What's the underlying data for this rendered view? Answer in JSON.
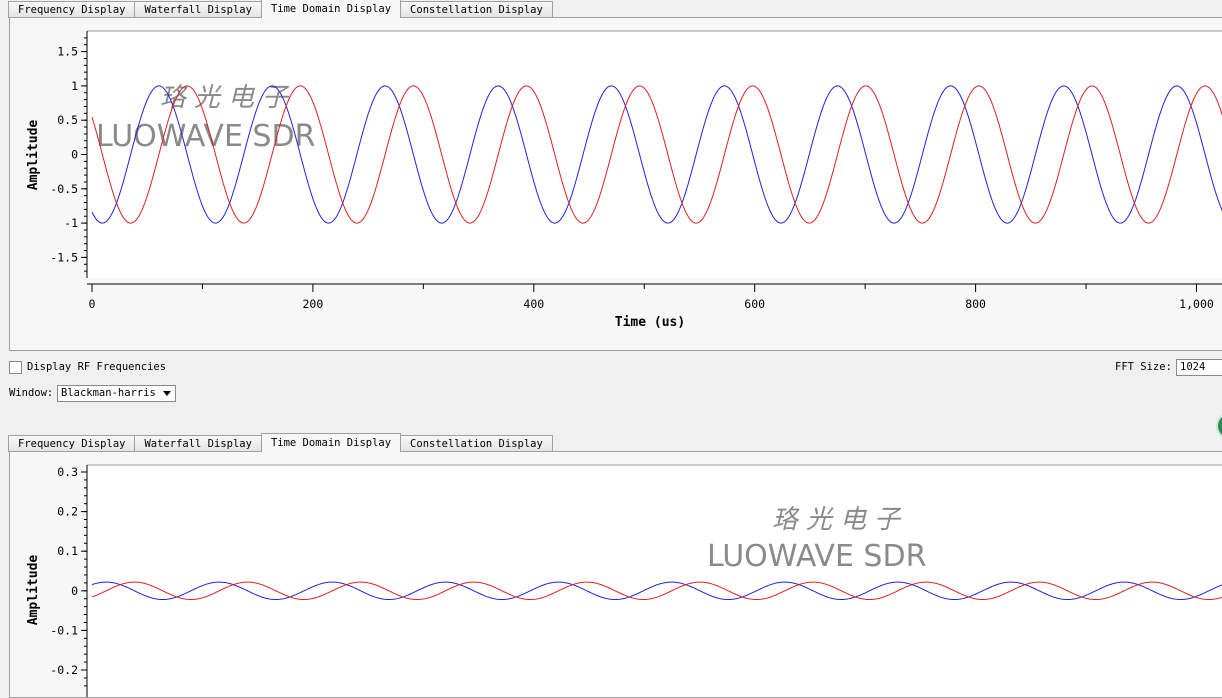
{
  "tabs": [
    "Frequency Display",
    "Waterfall Display",
    "Time Domain Display",
    "Constellation Display"
  ],
  "active_tab": 2,
  "top_plot": {
    "ylabel": "Amplitude",
    "xlabel": "Time (us)",
    "y_ticks": [
      "1.5",
      "1",
      "0.5",
      "0",
      "-0.5",
      "-1",
      "-1.5"
    ],
    "x_ticks": [
      "0",
      "200",
      "400",
      "600",
      "800",
      "1,000"
    ],
    "watermark_cn": "珞光电子",
    "watermark_en": "LUOWAVE SDR"
  },
  "controls": {
    "display_rf_label": "Display RF Frequencies",
    "fft_size_label": "FFT Size:",
    "fft_size_value": "1024",
    "window_label": "Window:",
    "window_value": "Blackman-harris"
  },
  "bottom_plot": {
    "ylabel": "Amplitude",
    "y_ticks": [
      "0.3",
      "0.2",
      "0.1",
      "0",
      "-0.1",
      "-0.2"
    ],
    "watermark_cn": "珞光电子",
    "watermark_en": "LUOWAVE SDR"
  },
  "colors": {
    "series_blue": "#2222dd",
    "series_red": "#e02020"
  },
  "chart_data": [
    {
      "type": "line",
      "ylabel": "Amplitude",
      "xlabel": "Time (us)",
      "xlim": [
        0,
        1024
      ],
      "ylim": [
        -1.8,
        1.8
      ],
      "series": [
        {
          "amplitude": 1.0,
          "period_us": 102.4,
          "phase_deg": 237
        },
        {
          "amplitude": 1.0,
          "period_us": 102.4,
          "phase_deg": 147
        }
      ]
    },
    {
      "type": "line",
      "ylabel": "Amplitude",
      "xlim": [
        0,
        1024
      ],
      "ylim": [
        -0.25,
        0.3
      ],
      "series": [
        {
          "amplitude": 0.022,
          "period_us": 102.4,
          "phase_deg": 45
        },
        {
          "amplitude": 0.022,
          "period_us": 102.4,
          "phase_deg": -45
        }
      ]
    }
  ]
}
